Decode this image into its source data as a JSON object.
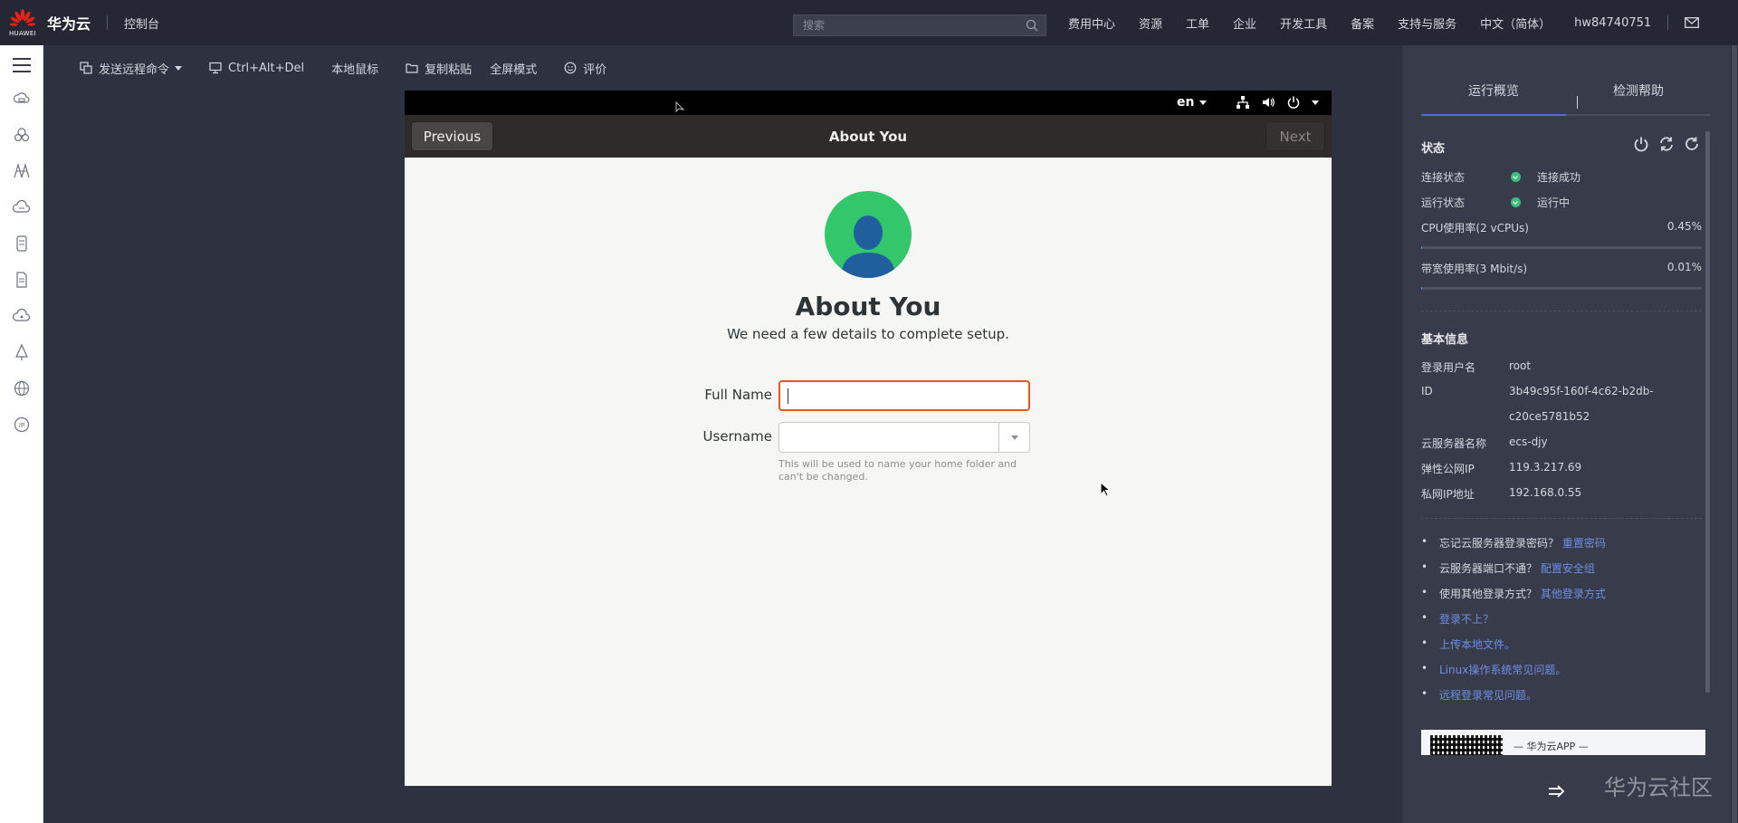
{
  "topbar": {
    "logo_text": "HUAWEI",
    "brand": "华为云",
    "console": "控制台",
    "search_placeholder": "搜索",
    "nav": [
      "费用中心",
      "资源",
      "工单",
      "企业",
      "开发工具",
      "备案",
      "支持与服务",
      "中文（简体）"
    ],
    "user": "hw84740751"
  },
  "sidebar": {
    "icons": [
      "cloud-server-icon",
      "cloud-cluster-icon",
      "network-icon",
      "cloud-storage-icon",
      "document-icon",
      "file-icon",
      "cloud-icon",
      "tree-icon",
      "globe-icon",
      "ip-icon"
    ]
  },
  "toolbar": {
    "send_command": "发送远程命令",
    "ctrl_alt_del": "Ctrl+Alt+Del",
    "local_mouse": "本地鼠标",
    "copy_paste": "复制粘贴",
    "fullscreen": "全屏模式",
    "rate": "评价"
  },
  "vm": {
    "lang": "en",
    "header": {
      "previous": "Previous",
      "title": "About You",
      "next": "Next"
    },
    "heading": "About You",
    "subtitle": "We need a few details to complete setup.",
    "full_name_label": "Full Name",
    "full_name_value": "",
    "username_label": "Username",
    "username_value": "",
    "hint": "This will be used to name your home folder and can't be changed."
  },
  "panel": {
    "tabs": [
      "运行概览",
      "检测帮助"
    ],
    "status_title": "状态",
    "connection_label": "连接状态",
    "connection_value": "连接成功",
    "run_label": "运行状态",
    "run_value": "运行中",
    "cpu_label": "CPU使用率(2 vCPUs)",
    "cpu_value": "0.45%",
    "cpu_usage": 0.0045,
    "bw_label": "带宽使用率(3 Mbit/s)",
    "bw_value": "0.01%",
    "bw_usage": 0.0001,
    "basic_title": "基本信息",
    "login_user_label": "登录用户名",
    "login_user_value": "root",
    "id_label": "ID",
    "id_value_1": "3b49c95f-160f-4c62-b2db-",
    "id_value_2": "c20ce5781b52",
    "server_name_label": "云服务器名称",
    "server_name_value": "ecs-djy",
    "eip_label": "弹性公网IP",
    "eip_value": "119.3.217.69",
    "private_ip_label": "私网IP地址",
    "private_ip_value": "192.168.0.55",
    "help": [
      {
        "text": "忘记云服务器登录密码？",
        "link": "重置密码"
      },
      {
        "text": "云服务器端口不通？",
        "link": "配置安全组"
      },
      {
        "text": "使用其他登录方式？",
        "link": "其他登录方式"
      },
      {
        "text": "",
        "link": "登录不上？"
      },
      {
        "text": "",
        "link": "上传本地文件。"
      },
      {
        "text": "",
        "link": "Linux操作系统常见问题。"
      },
      {
        "text": "",
        "link": "远程登录常见问题。"
      }
    ],
    "app_banner": "— 华为云APP —",
    "accent": "#526ecc",
    "success": "#3dbd7d",
    "link_color": "#6d8fe8"
  },
  "watermark": "华为云社区"
}
